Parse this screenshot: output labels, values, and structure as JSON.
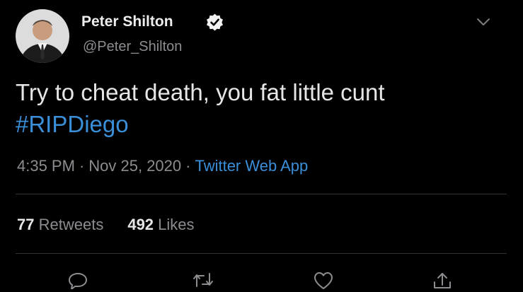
{
  "tweet": {
    "author": {
      "display_name": "Peter Shilton",
      "handle": "@Peter_Shilton",
      "verified": true
    },
    "text": "Try to cheat death, you fat little cunt",
    "hashtag": "#RIPDiego",
    "meta": {
      "time": "4:35 PM",
      "separator": "·",
      "date": "Nov 25, 2020",
      "source": "Twitter Web App"
    },
    "stats": {
      "retweets_count": "77",
      "retweets_label": "Retweets",
      "likes_count": "492",
      "likes_label": "Likes"
    },
    "actions": [
      "reply-icon",
      "retweet-icon",
      "like-icon",
      "share-icon"
    ]
  },
  "colors": {
    "background": "#000000",
    "link": "#3a8fd8",
    "secondary_text": "#8b8d90",
    "divider": "#2f3336"
  }
}
